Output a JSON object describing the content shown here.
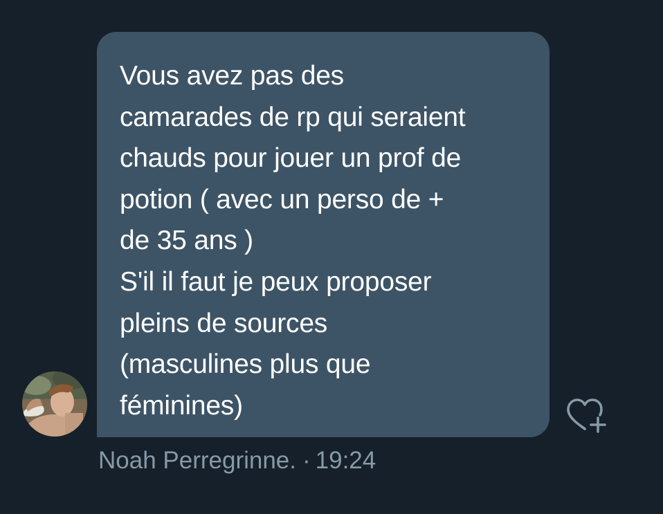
{
  "message": {
    "lines": [
      "Vous avez pas des",
      "camarades de rp qui seraient",
      "chauds pour jouer un prof de",
      "potion ( avec un perso de +",
      "de 35 ans )",
      "S'il il faut je peux proposer",
      "pleins de sources",
      "(masculines plus que",
      "féminines)"
    ],
    "sender": "Noah Perregrinne.",
    "separator": "·",
    "time": "19:24"
  },
  "icons": {
    "avatar": "user-avatar-photo",
    "reaction": "heart-plus-icon"
  },
  "colors": {
    "background": "#15202b",
    "bubble": "#3d5466",
    "text": "#ffffff",
    "meta": "#8899a6",
    "icon": "#8899a6"
  }
}
